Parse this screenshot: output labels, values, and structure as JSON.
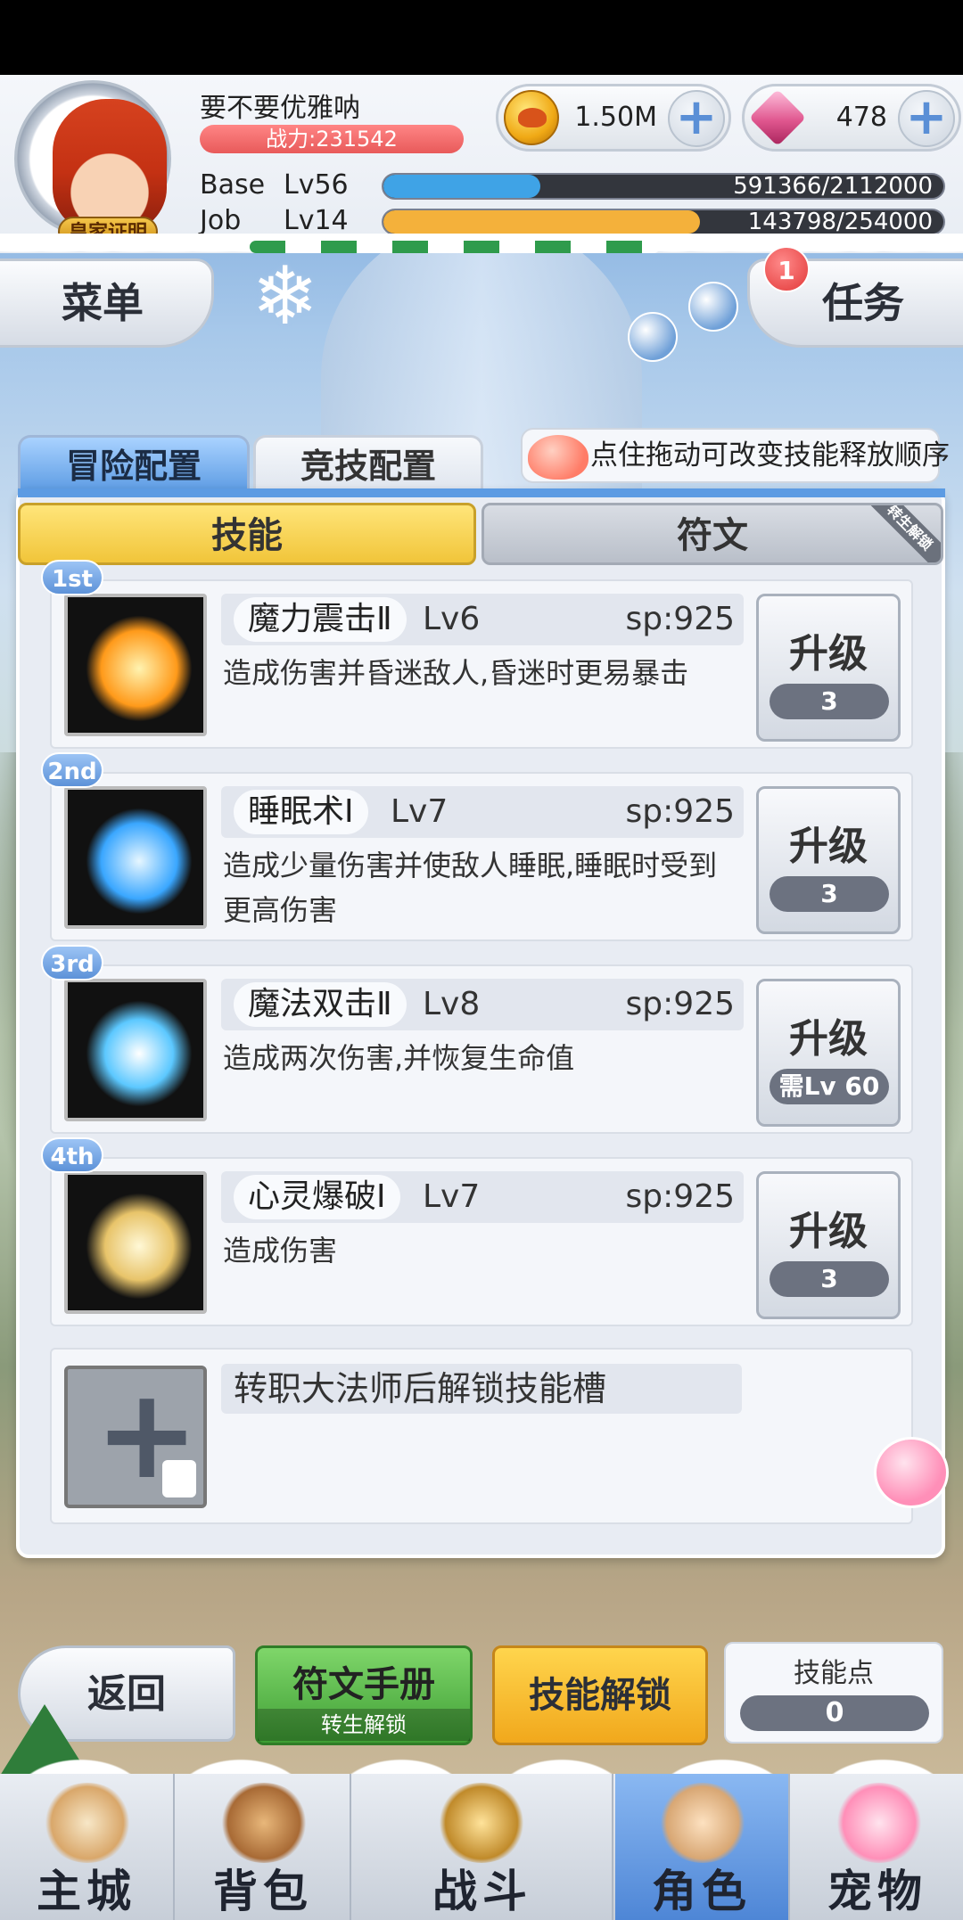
{
  "player": {
    "name": "要不要优雅呐",
    "power": "战力:231542",
    "badge": "皇家证明"
  },
  "currencies": [
    {
      "icon": "gold-coin-icon",
      "value": "1.50M"
    },
    {
      "icon": "gem-icon",
      "value": "478"
    }
  ],
  "exp": {
    "base_label": "Base",
    "base_level": "Lv56",
    "base_text": "591366/2112000",
    "base_fraction": 0.28,
    "job_label": "Job",
    "job_level": "Lv14",
    "job_text": "143798/254000",
    "job_fraction": 0.566
  },
  "top_buttons": {
    "menu": "菜单",
    "tasks": "任务",
    "task_badge": "1"
  },
  "config_tabs": [
    "冒险配置",
    "竞技配置"
  ],
  "hint": "点住拖动可改变技能释放顺序",
  "sub_tabs": {
    "skills": "技能",
    "runes": "符文",
    "runes_ribbon": "转生解锁"
  },
  "skills": [
    {
      "rank": "1st",
      "name": "魔力震击Ⅱ",
      "level": "Lv6",
      "sp": "sp:925",
      "desc": "造成伤害并昏迷敌人,昏迷时更易暴击",
      "upgrade": "升级",
      "cost": "3"
    },
    {
      "rank": "2nd",
      "name": "睡眠术Ⅰ",
      "level": "Lv7",
      "sp": "sp:925",
      "desc": "造成少量伤害并使敌人睡眠,睡眠时受到更高伤害",
      "upgrade": "升级",
      "cost": "3"
    },
    {
      "rank": "3rd",
      "name": "魔法双击Ⅱ",
      "level": "Lv8",
      "sp": "sp:925",
      "desc": "造成两次伤害,并恢复生命值",
      "upgrade": "升级",
      "cost": "需Lv 60"
    },
    {
      "rank": "4th",
      "name": "心灵爆破Ⅰ",
      "level": "Lv7",
      "sp": "sp:925",
      "desc": "造成伤害",
      "upgrade": "升级",
      "cost": "3"
    }
  ],
  "locked_slot": "转职大法师后解锁技能槽",
  "actions": {
    "back": "返回",
    "rune_manual": "符文手册",
    "rune_manual_sub": "转生解锁",
    "skill_unlock": "技能解锁",
    "skill_points_label": "技能点",
    "skill_points": "0"
  },
  "nav": [
    "主城",
    "背包",
    "战斗",
    "角色",
    "宠物"
  ],
  "colors": {
    "base_exp": "#3fa3e6",
    "job_exp": "#f4b13b",
    "active_tab": "#5c9be3"
  }
}
